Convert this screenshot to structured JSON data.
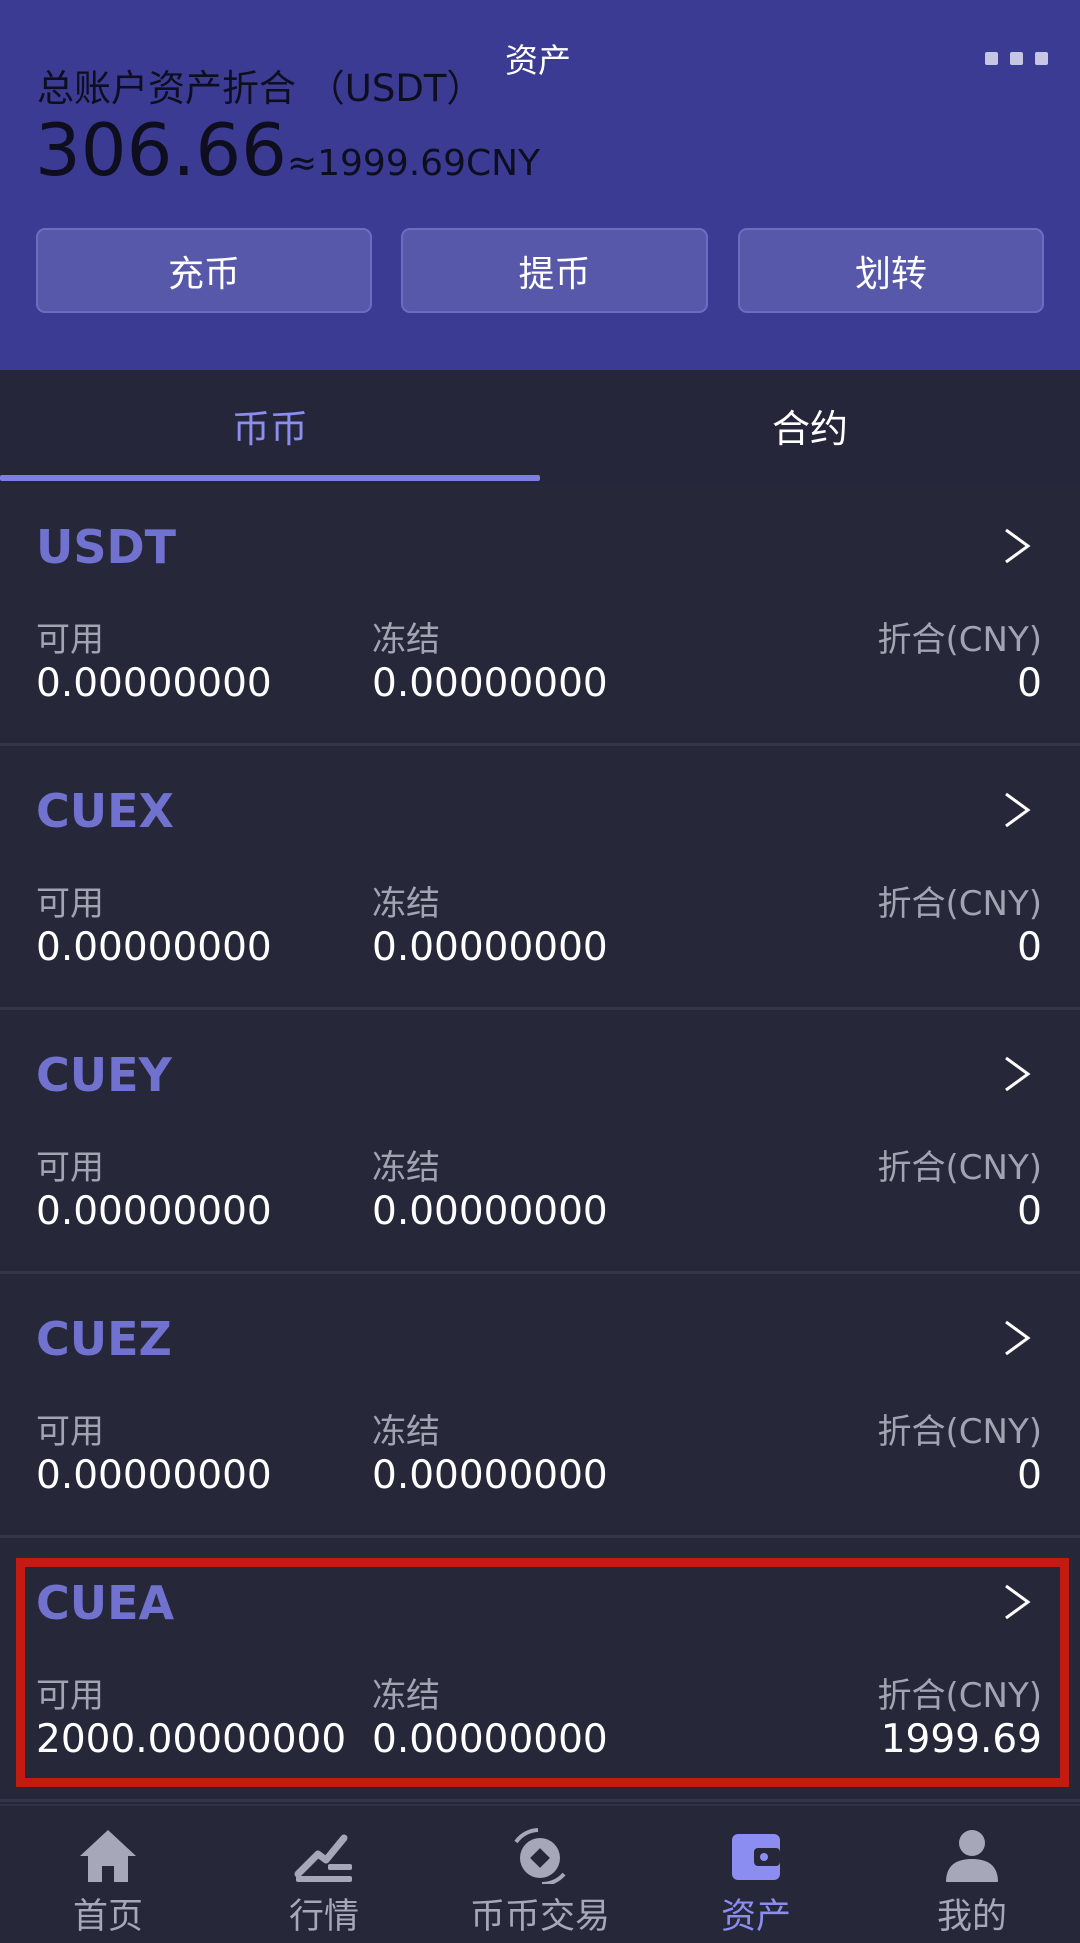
{
  "header": {
    "title": "资产",
    "total_label": "总账户资产折合 （USDT）",
    "total_amount": "306.66",
    "total_cny": "≈1999.69CNY",
    "buttons": {
      "deposit": "充币",
      "withdraw": "提币",
      "transfer": "划转"
    }
  },
  "tabs": [
    {
      "label": "币币",
      "active": true
    },
    {
      "label": "合约",
      "active": false
    }
  ],
  "labels": {
    "available": "可用",
    "frozen": "冻结",
    "equivalent": "折合(CNY)"
  },
  "assets": [
    {
      "name": "USDT",
      "available": "0.00000000",
      "frozen": "0.00000000",
      "cny": "0"
    },
    {
      "name": "CUEX",
      "available": "0.00000000",
      "frozen": "0.00000000",
      "cny": "0"
    },
    {
      "name": "CUEY",
      "available": "0.00000000",
      "frozen": "0.00000000",
      "cny": "0"
    },
    {
      "name": "CUEZ",
      "available": "0.00000000",
      "frozen": "0.00000000",
      "cny": "0"
    },
    {
      "name": "CUEA",
      "available": "2000.00000000",
      "frozen": "0.00000000",
      "cny": "1999.69"
    }
  ],
  "nav": [
    {
      "label": "首页",
      "icon": "home-icon",
      "active": false
    },
    {
      "label": "行情",
      "icon": "market-icon",
      "active": false
    },
    {
      "label": "币币交易",
      "icon": "exchange-icon",
      "active": false
    },
    {
      "label": "资产",
      "icon": "wallet-icon",
      "active": true
    },
    {
      "label": "我的",
      "icon": "user-icon",
      "active": false
    }
  ],
  "colors": {
    "header_bg": "#3b3b93",
    "accent": "#7172cf",
    "active_tab": "#8b8df0",
    "highlight": "#c31a12",
    "page_bg": "#262738"
  }
}
